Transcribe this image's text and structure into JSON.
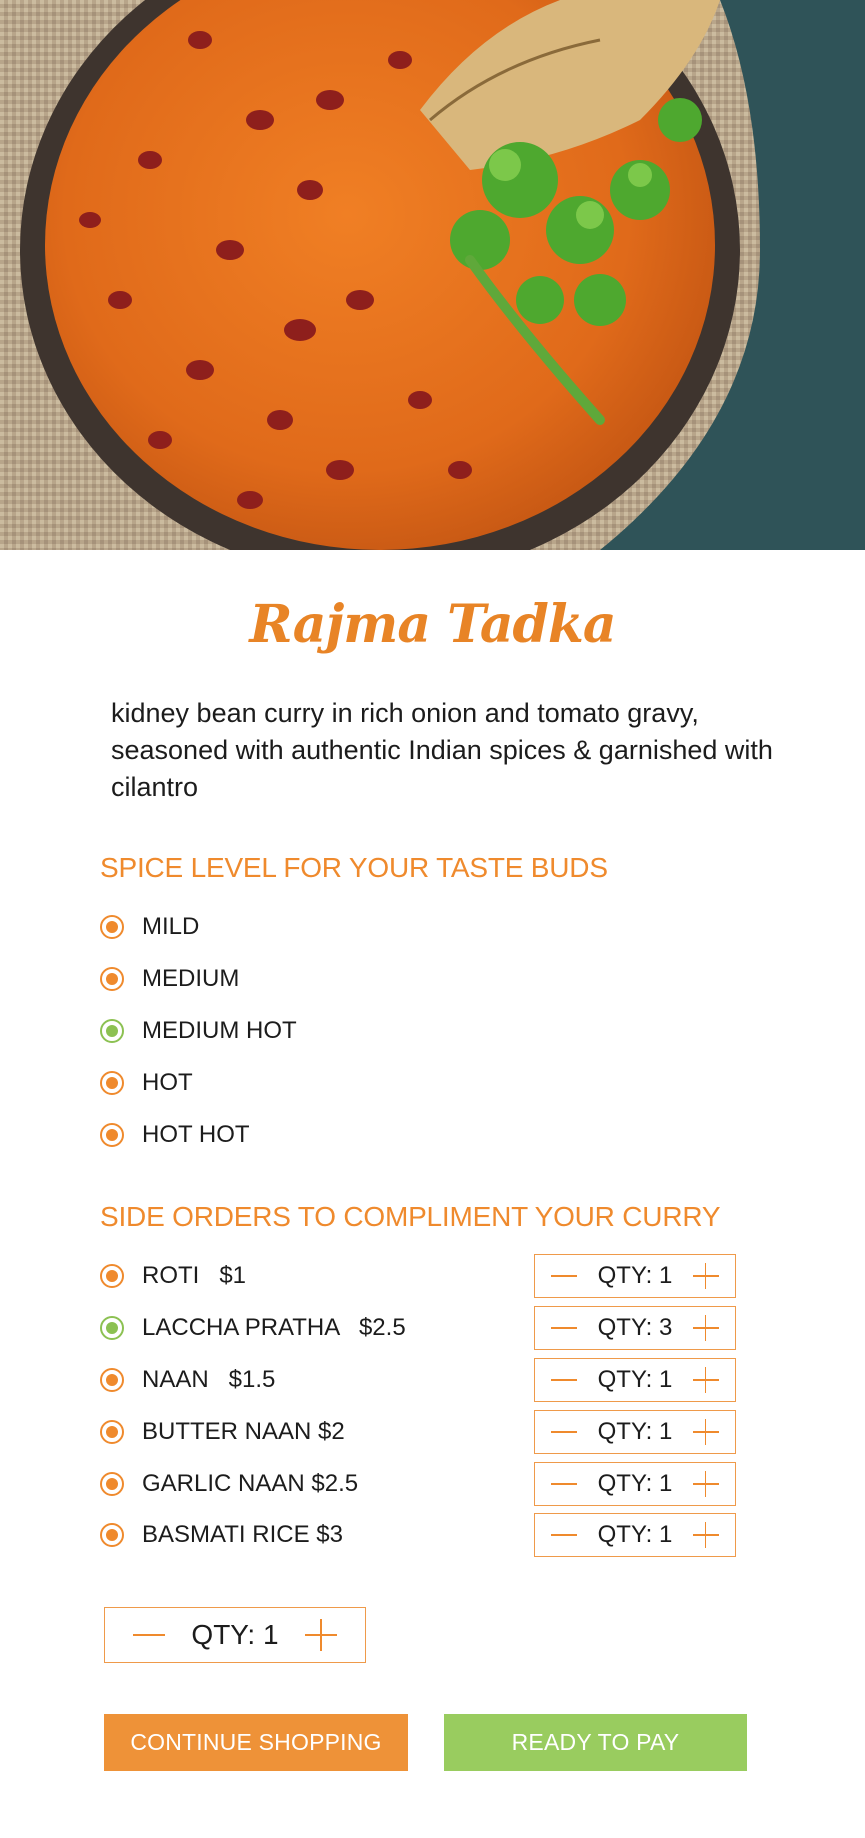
{
  "product": {
    "title": "Rajma Tadka",
    "description": "kidney bean curry in rich onion and tomato gravy, seasoned with authentic Indian spices & garnished with cilantro"
  },
  "spice": {
    "heading": "SPICE LEVEL FOR YOUR TASTE BUDS",
    "options": [
      {
        "label": "MILD",
        "selected": false
      },
      {
        "label": "MEDIUM",
        "selected": false
      },
      {
        "label": "MEDIUM HOT",
        "selected": true
      },
      {
        "label": "HOT",
        "selected": false
      },
      {
        "label": "HOT HOT",
        "selected": false
      }
    ]
  },
  "sides": {
    "heading": "SIDE ORDERS TO COMPLIMENT YOUR CURRY",
    "items": [
      {
        "label": "ROTI   $1",
        "qty": "QTY: 1",
        "selected": false
      },
      {
        "label": "LACCHA PRATHA   $2.5",
        "qty": "QTY: 3",
        "selected": true
      },
      {
        "label": "NAAN   $1.5",
        "qty": "QTY: 1",
        "selected": false
      },
      {
        "label": "BUTTER NAAN $2",
        "qty": "QTY: 1",
        "selected": false
      },
      {
        "label": "GARLIC NAAN $2.5",
        "qty": "QTY: 1",
        "selected": false
      },
      {
        "label": "BASMATI RICE $3",
        "qty": "QTY: 1",
        "selected": false
      }
    ]
  },
  "order": {
    "qty": "QTY: 1"
  },
  "actions": {
    "continue": "CONTINUE SHOPPING",
    "pay": "READY TO PAY"
  },
  "colors": {
    "accent_orange": "#ef8a2d",
    "selected_green": "#8cc152",
    "continue_button": "#ee9238",
    "pay_button": "#99cc5f"
  },
  "icons": {
    "decrement": "minus-icon",
    "increment": "plus-icon",
    "radio": "radio-dot-icon"
  }
}
